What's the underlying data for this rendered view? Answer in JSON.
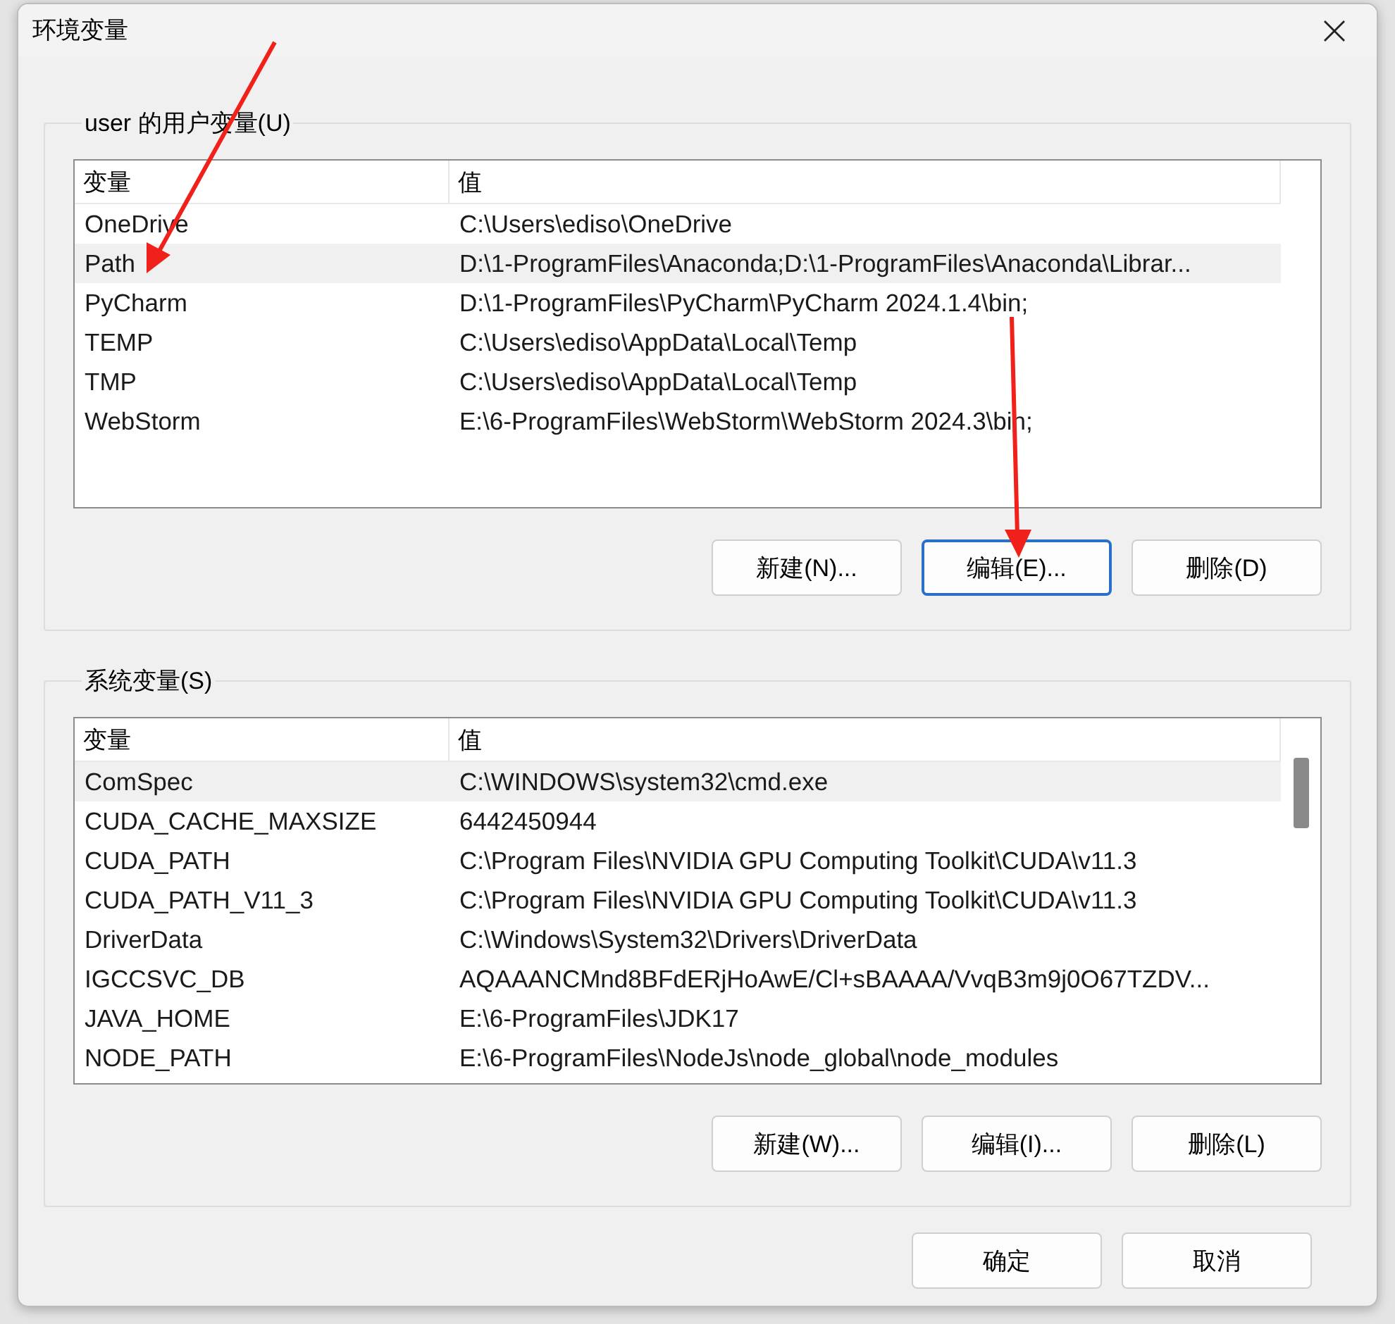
{
  "window": {
    "title": "环境变量"
  },
  "user_group": {
    "title": "user 的用户变量(U)",
    "table": {
      "columns": [
        "变量",
        "值"
      ],
      "rows": [
        {
          "name": "OneDrive",
          "value": "C:\\Users\\ediso\\OneDrive",
          "selected": false
        },
        {
          "name": "Path",
          "value": "D:\\1-ProgramFiles\\Anaconda;D:\\1-ProgramFiles\\Anaconda\\Librar...",
          "selected": true
        },
        {
          "name": "PyCharm",
          "value": "D:\\1-ProgramFiles\\PyCharm\\PyCharm 2024.1.4\\bin;",
          "selected": false
        },
        {
          "name": "TEMP",
          "value": "C:\\Users\\ediso\\AppData\\Local\\Temp",
          "selected": false
        },
        {
          "name": "TMP",
          "value": "C:\\Users\\ediso\\AppData\\Local\\Temp",
          "selected": false
        },
        {
          "name": "WebStorm",
          "value": "E:\\6-ProgramFiles\\WebStorm\\WebStorm 2024.3\\bin;",
          "selected": false
        }
      ]
    },
    "buttons": [
      {
        "label": "新建(N)...",
        "focused": false
      },
      {
        "label": "编辑(E)...",
        "focused": true
      },
      {
        "label": "删除(D)",
        "focused": false
      }
    ]
  },
  "system_group": {
    "title": "系统变量(S)",
    "table": {
      "columns": [
        "变量",
        "值"
      ],
      "rows": [
        {
          "name": "ComSpec",
          "value": "C:\\WINDOWS\\system32\\cmd.exe",
          "selected": true
        },
        {
          "name": "CUDA_CACHE_MAXSIZE",
          "value": "6442450944",
          "selected": false
        },
        {
          "name": "CUDA_PATH",
          "value": "C:\\Program Files\\NVIDIA GPU Computing Toolkit\\CUDA\\v11.3",
          "selected": false
        },
        {
          "name": "CUDA_PATH_V11_3",
          "value": "C:\\Program Files\\NVIDIA GPU Computing Toolkit\\CUDA\\v11.3",
          "selected": false
        },
        {
          "name": "DriverData",
          "value": "C:\\Windows\\System32\\Drivers\\DriverData",
          "selected": false
        },
        {
          "name": "IGCCSVC_DB",
          "value": "AQAAANCMnd8BFdERjHoAwE/Cl+sBAAAA/VvqB3m9j0O67TZDV...",
          "selected": false
        },
        {
          "name": "JAVA_HOME",
          "value": "E:\\6-ProgramFiles\\JDK17",
          "selected": false
        },
        {
          "name": "NODE_PATH",
          "value": "E:\\6-ProgramFiles\\NodeJs\\node_global\\node_modules",
          "selected": false
        }
      ]
    },
    "buttons": [
      {
        "label": "新建(W)...",
        "focused": false
      },
      {
        "label": "编辑(I)...",
        "focused": false
      },
      {
        "label": "删除(L)",
        "focused": false
      }
    ]
  },
  "footer_buttons": [
    {
      "label": "确定",
      "focused": false
    },
    {
      "label": "取消",
      "focused": false
    }
  ]
}
